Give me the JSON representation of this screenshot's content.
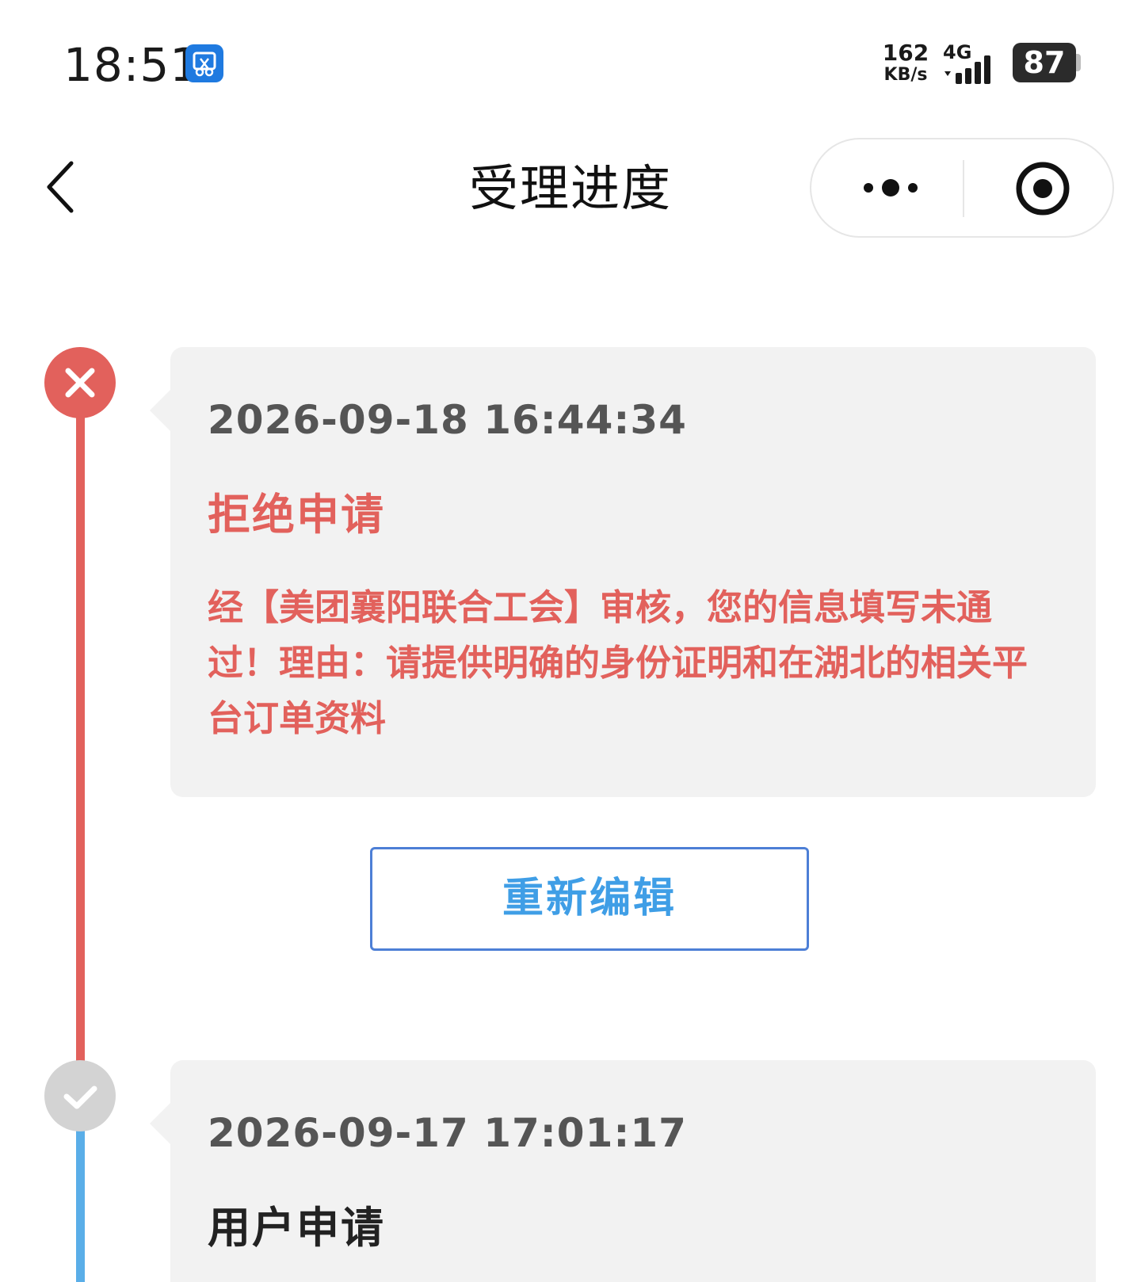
{
  "status_bar": {
    "time": "18:51",
    "app_icon": "screenshot-app-icon",
    "net_speed_value": "162",
    "net_speed_unit": "KB/s",
    "network_type": "4G",
    "battery_level": "87"
  },
  "nav": {
    "back_icon": "chevron-left-icon",
    "title": "受理进度",
    "more_icon": "more-dots-icon",
    "close_icon": "target-close-icon"
  },
  "timeline": [
    {
      "state": "rejected",
      "icon": "close-icon",
      "time": "2026-09-18 16:44:34",
      "status": "拒绝申请",
      "description": "经【美团襄阳联合工会】审核，您的信息填写未通过！理由：请提供明确的身份证明和在湖北的相关平台订单资料",
      "action_label": "重新编辑"
    },
    {
      "state": "done",
      "icon": "check-icon",
      "time": "2026-09-17 17:01:17",
      "status": "用户申请"
    }
  ],
  "colors": {
    "reject_red": "#e2615c",
    "button_border": "#4d7fd6",
    "button_text": "#3f9ee6",
    "timeline_blue": "#5aaee8",
    "card_bg": "#f2f2f2"
  }
}
